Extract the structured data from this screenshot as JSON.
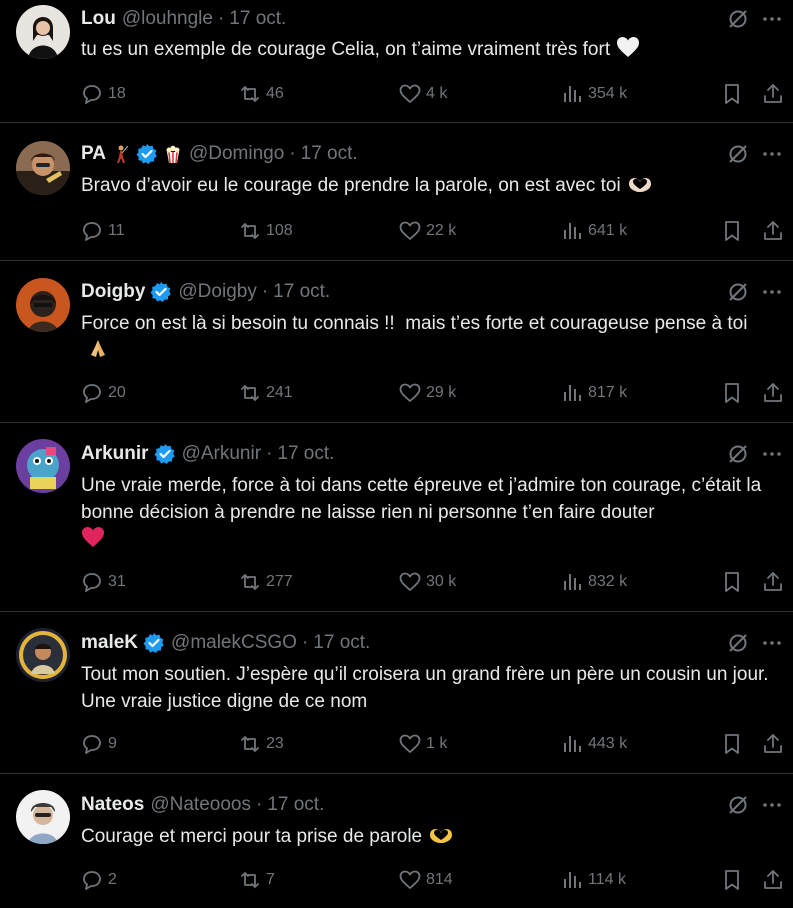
{
  "tweets": [
    {
      "name": "Lou",
      "handle": "@louhngle",
      "date": "17 oct.",
      "text": "tu es un exemple de courage Celia, on t’aime vraiment très fort",
      "text_emoji": "white-heart-emoji",
      "replies": "18",
      "retweets": "46",
      "likes": "4 k",
      "views": "354 k",
      "verified": false,
      "avatar_color": "#d9d4d0"
    },
    {
      "name": "PA",
      "handle": "@Domingo",
      "date": "17 oct.",
      "text": "Bravo d’avoir eu le courage de prendre la parole, on est avec toi",
      "text_emoji": "heart-hands-emoji",
      "replies": "11",
      "retweets": "108",
      "likes": "22 k",
      "views": "641 k",
      "verified": true,
      "name_emojis": [
        "person-golfing-emoji",
        "popcorn-emoji"
      ],
      "avatar_color": "#6b4a35"
    },
    {
      "name": "Doigby",
      "handle": "@Doigby",
      "date": "17 oct.",
      "text": "Force on est là si besoin tu connais !!  mais t’es forte et courageuse pense à toi",
      "text_emoji": "folded-hands-emoji",
      "replies": "20",
      "retweets": "241",
      "likes": "29 k",
      "views": "817 k",
      "verified": true,
      "avatar_color": "#c8561e"
    },
    {
      "name": "Arkunir",
      "handle": "@Arkunir",
      "date": "17 oct.",
      "text": "Une vraie merde, force à toi dans cette épreuve et j’admire ton courage, c’était la bonne décision à prendre ne laisse rien ni personne t’en faire douter",
      "text_emoji": "red-heart-emoji",
      "replies": "31",
      "retweets": "277",
      "likes": "30 k",
      "views": "832 k",
      "verified": true,
      "avatar_color": "#4aa3c9"
    },
    {
      "name": "maleK",
      "handle": "@malekCSGO",
      "date": "17 oct.",
      "text": "Tout mon soutien. J’espère qu’il croisera un grand frère un père un cousin un jour. Une vraie justice digne de ce nom",
      "text_emoji": "",
      "replies": "9",
      "retweets": "23",
      "likes": "1 k",
      "views": "443 k",
      "verified": true,
      "avatar_color": "#e3b33b"
    },
    {
      "name": "Nateos",
      "handle": "@Nateooos",
      "date": "17 oct.",
      "text": "Courage et merci pour ta prise de parole",
      "text_emoji": "yellow-heart-hands-emoji",
      "replies": "2",
      "retweets": "7",
      "likes": "814",
      "views": "114 k",
      "verified": false,
      "avatar_color": "#e8e8e8"
    }
  ],
  "colors": {
    "background": "#000000",
    "text": "#e7e9ea",
    "muted": "#71767b",
    "divider": "#2f3336",
    "verified": "#1d9bf0"
  }
}
